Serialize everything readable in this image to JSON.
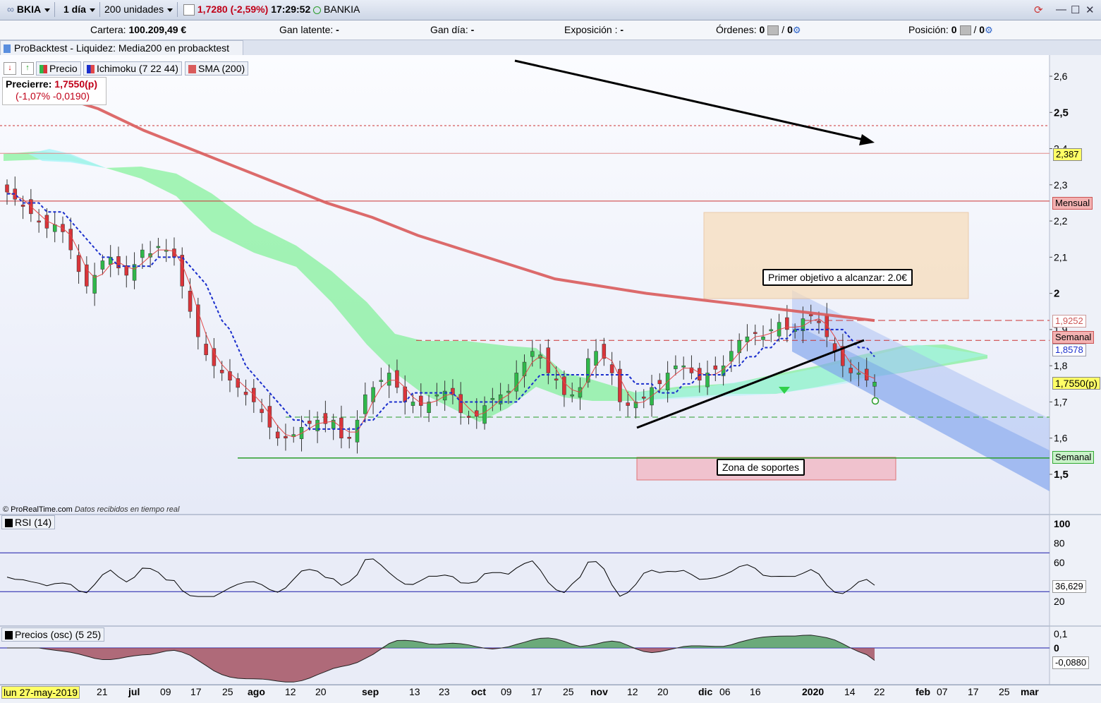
{
  "toolbar": {
    "ticker": "BKIA",
    "timeframe": "1 día",
    "units": "200 unidades",
    "price": "1,7280 (-2,59%)",
    "time": "17:29:52",
    "name": "BANKIA"
  },
  "account": {
    "cartera_label": "Cartera:",
    "cartera_value": "100.209,49 €",
    "gan_latente_label": "Gan latente:",
    "gan_latente_value": "-",
    "gan_dia_label": "Gan día:",
    "gan_dia_value": "-",
    "exposicion_label": "Exposición :",
    "exposicion_value": "-",
    "ordenes_label": "Órdenes:",
    "ordenes_value1": "0",
    "ordenes_value2": "0",
    "posicion_label": "Posición:",
    "posicion_value1": "0",
    "posicion_value2": "0"
  },
  "probacktest": "ProBacktest - Liquidez: Media200 en probacktest",
  "legend": {
    "precio": "Precio",
    "ichimoku": "Ichimoku (7 22 44)",
    "sma": "SMA (200)"
  },
  "precierre": {
    "label": "Precierre:",
    "value": "1,7550(p)",
    "change": "(-1,07% -0,0190)"
  },
  "copyright": "© ProRealTime.com",
  "realtime_note": "Datos recibidos en tiempo real",
  "annotations": {
    "target": "Primer objetivo a alcanzar: 2.0€",
    "support": "Zona de soportes"
  },
  "price_tags": {
    "level_2387": "2,387",
    "mensual": "Mensual",
    "level_19252": "1,9252",
    "semanal_top": "Semanal",
    "level_18578": "1,8578",
    "current": "1,7550(p)",
    "semanal_bottom": "Semanal",
    "rsi_value": "36,629",
    "osc_value": "-0,0880"
  },
  "rsi_panel": {
    "title": "RSI (14)"
  },
  "osc_panel": {
    "title": "Precios (osc) (5 25)"
  },
  "date_start": "lun 27-may-2019",
  "colors": {
    "bull": "#2fb84a",
    "bear": "#d9343a",
    "sma": "#d95b5b",
    "tenkan": "#e24848",
    "kijun": "#1a2ecc",
    "cloud_bull": "#5ef07a",
    "cloud_bear": "#a8f4f8"
  },
  "chart_data": {
    "type": "candlestick",
    "instrument": "BKIA",
    "y_ticks": [
      "2,6",
      "2,5",
      "2,4",
      "2,3",
      "2,2",
      "2,1",
      "2",
      "1,9",
      "1,8",
      "1,7",
      "1,6",
      "1,5"
    ],
    "x_ticks": [
      "21",
      "jul",
      "09",
      "17",
      "25",
      "ago",
      "12",
      "20",
      "sep",
      "13",
      "23",
      "oct",
      "09",
      "17",
      "25",
      "nov",
      "12",
      "20",
      "dic",
      "06",
      "16",
      "2020",
      "14",
      "22",
      "feb",
      "07",
      "17",
      "25",
      "mar"
    ],
    "horizontal_levels": [
      {
        "label": "Mensual",
        "value": 2.255
      },
      {
        "label": "Semanal",
        "value": 1.87
      },
      {
        "label": "Semanal",
        "value": 1.545
      },
      {
        "label": "2,387",
        "value": 2.387
      },
      {
        "label": "1,9252",
        "value": 1.9252
      }
    ],
    "close_series": [
      2.28,
      2.26,
      2.24,
      2.22,
      2.2,
      2.18,
      2.19,
      2.17,
      2.12,
      2.06,
      2.02,
      2.05,
      2.09,
      2.1,
      2.07,
      2.05,
      2.08,
      2.12,
      2.11,
      2.13,
      2.12,
      2.1,
      2.02,
      1.95,
      1.88,
      1.83,
      1.8,
      1.78,
      1.76,
      1.74,
      1.72,
      1.7,
      1.67,
      1.63,
      1.6,
      1.6,
      1.61,
      1.63,
      1.64,
      1.65,
      1.64,
      1.65,
      1.6,
      1.6,
      1.65,
      1.72,
      1.74,
      1.76,
      1.78,
      1.74,
      1.7,
      1.7,
      1.69,
      1.7,
      1.72,
      1.73,
      1.72,
      1.67,
      1.66,
      1.66,
      1.69,
      1.71,
      1.72,
      1.73,
      1.78,
      1.81,
      1.84,
      1.83,
      1.78,
      1.76,
      1.72,
      1.72,
      1.74,
      1.82,
      1.84,
      1.82,
      1.78,
      1.7,
      1.69,
      1.7,
      1.71,
      1.74,
      1.75,
      1.78,
      1.8,
      1.8,
      1.78,
      1.76,
      1.78,
      1.79,
      1.8,
      1.84,
      1.87,
      1.88,
      1.89,
      1.88,
      1.9,
      1.92,
      1.9,
      1.9,
      1.93,
      1.94,
      1.92,
      1.88,
      1.84,
      1.8,
      1.78,
      1.78,
      1.76,
      1.755
    ],
    "sma_200": [
      2.57,
      2.55,
      2.51,
      2.45,
      2.4,
      2.35,
      2.3,
      2.25,
      2.21,
      2.16,
      2.12,
      2.08,
      2.04,
      2.02,
      2.0,
      1.985,
      1.97,
      1.955,
      1.94,
      1.925
    ],
    "rsi": {
      "ticks": [
        "100",
        "80",
        "60",
        "20"
      ],
      "levels": [
        70,
        30
      ],
      "last": 36.629
    },
    "oscillator": {
      "ticks": [
        "0,1",
        "0"
      ],
      "last": -0.088
    }
  }
}
